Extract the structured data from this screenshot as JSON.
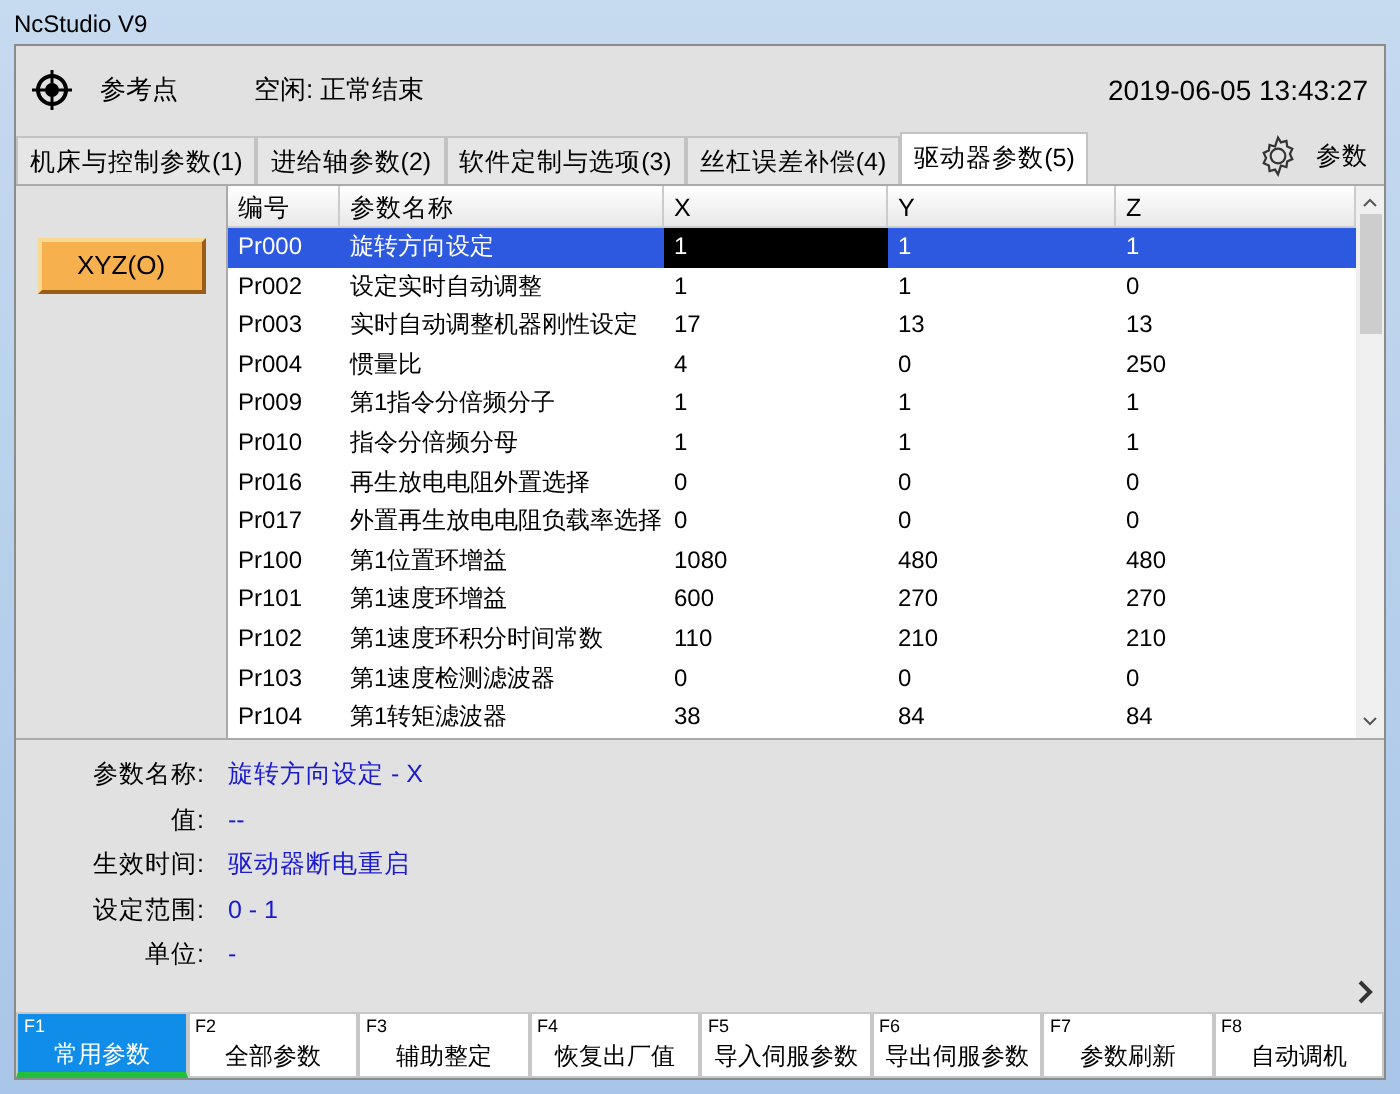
{
  "window": {
    "title": "NcStudio V9"
  },
  "status": {
    "reference": "参考点",
    "state": "空闲: 正常结束",
    "datetime": "2019-06-05 13:43:27"
  },
  "tabs": [
    {
      "label": "机床与控制参数(1)",
      "selected": false
    },
    {
      "label": "进给轴参数(2)",
      "selected": false
    },
    {
      "label": "软件定制与选项(3)",
      "selected": false
    },
    {
      "label": "丝杠误差补偿(4)",
      "selected": false
    },
    {
      "label": "驱动器参数(5)",
      "selected": true
    }
  ],
  "settings_button": {
    "label": "参数"
  },
  "axis_button": {
    "label": "XYZ(O)"
  },
  "table": {
    "columns": [
      "编号",
      "参数名称",
      "X",
      "Y",
      "Z"
    ],
    "rows": [
      {
        "selected": true,
        "cells": [
          {
            "text": "Pr000",
            "focused": false
          },
          {
            "text": "旋转方向设定",
            "focused": false
          },
          {
            "text": "1",
            "focused": true
          },
          {
            "text": "1",
            "focused": false
          },
          {
            "text": "1",
            "focused": false
          }
        ]
      },
      {
        "selected": false,
        "cells": [
          {
            "text": "Pr002",
            "focused": false
          },
          {
            "text": "设定实时自动调整",
            "focused": false
          },
          {
            "text": "1",
            "focused": false
          },
          {
            "text": "1",
            "focused": false
          },
          {
            "text": "0",
            "focused": false
          }
        ]
      },
      {
        "selected": false,
        "cells": [
          {
            "text": "Pr003",
            "focused": false
          },
          {
            "text": "实时自动调整机器刚性设定",
            "focused": false
          },
          {
            "text": "17",
            "focused": false
          },
          {
            "text": "13",
            "focused": false
          },
          {
            "text": "13",
            "focused": false
          }
        ]
      },
      {
        "selected": false,
        "cells": [
          {
            "text": "Pr004",
            "focused": false
          },
          {
            "text": "惯量比",
            "focused": false
          },
          {
            "text": "4",
            "focused": false
          },
          {
            "text": "0",
            "focused": false
          },
          {
            "text": "250",
            "focused": false
          }
        ]
      },
      {
        "selected": false,
        "cells": [
          {
            "text": "Pr009",
            "focused": false
          },
          {
            "text": "第1指令分倍频分子",
            "focused": false
          },
          {
            "text": "1",
            "focused": false
          },
          {
            "text": "1",
            "focused": false
          },
          {
            "text": "1",
            "focused": false
          }
        ]
      },
      {
        "selected": false,
        "cells": [
          {
            "text": "Pr010",
            "focused": false
          },
          {
            "text": "指令分倍频分母",
            "focused": false
          },
          {
            "text": "1",
            "focused": false
          },
          {
            "text": "1",
            "focused": false
          },
          {
            "text": "1",
            "focused": false
          }
        ]
      },
      {
        "selected": false,
        "cells": [
          {
            "text": "Pr016",
            "focused": false
          },
          {
            "text": "再生放电电阻外置选择",
            "focused": false
          },
          {
            "text": "0",
            "focused": false
          },
          {
            "text": "0",
            "focused": false
          },
          {
            "text": "0",
            "focused": false
          }
        ]
      },
      {
        "selected": false,
        "cells": [
          {
            "text": "Pr017",
            "focused": false
          },
          {
            "text": "外置再生放电电阻负载率选择",
            "focused": false
          },
          {
            "text": "0",
            "focused": false
          },
          {
            "text": "0",
            "focused": false
          },
          {
            "text": "0",
            "focused": false
          }
        ]
      },
      {
        "selected": false,
        "cells": [
          {
            "text": "Pr100",
            "focused": false
          },
          {
            "text": "第1位置环增益",
            "focused": false
          },
          {
            "text": "1080",
            "focused": false
          },
          {
            "text": "480",
            "focused": false
          },
          {
            "text": "480",
            "focused": false
          }
        ]
      },
      {
        "selected": false,
        "cells": [
          {
            "text": "Pr101",
            "focused": false
          },
          {
            "text": "第1速度环增益",
            "focused": false
          },
          {
            "text": "600",
            "focused": false
          },
          {
            "text": "270",
            "focused": false
          },
          {
            "text": "270",
            "focused": false
          }
        ]
      },
      {
        "selected": false,
        "cells": [
          {
            "text": "Pr102",
            "focused": false
          },
          {
            "text": "第1速度环积分时间常数",
            "focused": false
          },
          {
            "text": "110",
            "focused": false
          },
          {
            "text": "210",
            "focused": false
          },
          {
            "text": "210",
            "focused": false
          }
        ]
      },
      {
        "selected": false,
        "cells": [
          {
            "text": "Pr103",
            "focused": false
          },
          {
            "text": "第1速度检测滤波器",
            "focused": false
          },
          {
            "text": "0",
            "focused": false
          },
          {
            "text": "0",
            "focused": false
          },
          {
            "text": "0",
            "focused": false
          }
        ]
      },
      {
        "selected": false,
        "cells": [
          {
            "text": "Pr104",
            "focused": false
          },
          {
            "text": "第1转矩滤波器",
            "focused": false
          },
          {
            "text": "38",
            "focused": false
          },
          {
            "text": "84",
            "focused": false
          },
          {
            "text": "84",
            "focused": false
          }
        ]
      }
    ]
  },
  "details": [
    {
      "label": "参数名称:",
      "value": "旋转方向设定 - X"
    },
    {
      "label": "值:",
      "value": "--"
    },
    {
      "label": "生效时间:",
      "value": "驱动器断电重启"
    },
    {
      "label": "设定范围:",
      "value": "0 - 1"
    },
    {
      "label": "单位:",
      "value": "-"
    }
  ],
  "function_keys": [
    {
      "key": "F1",
      "label": "常用参数",
      "selected": true
    },
    {
      "key": "F2",
      "label": "全部参数",
      "selected": false
    },
    {
      "key": "F3",
      "label": "辅助整定",
      "selected": false
    },
    {
      "key": "F4",
      "label": "恢复出厂值",
      "selected": false
    },
    {
      "key": "F5",
      "label": "导入伺服参数",
      "selected": false
    },
    {
      "key": "F6",
      "label": "导出伺服参数",
      "selected": false
    },
    {
      "key": "F7",
      "label": "参数刷新",
      "selected": false
    },
    {
      "key": "F8",
      "label": "自动调机",
      "selected": false
    }
  ]
}
